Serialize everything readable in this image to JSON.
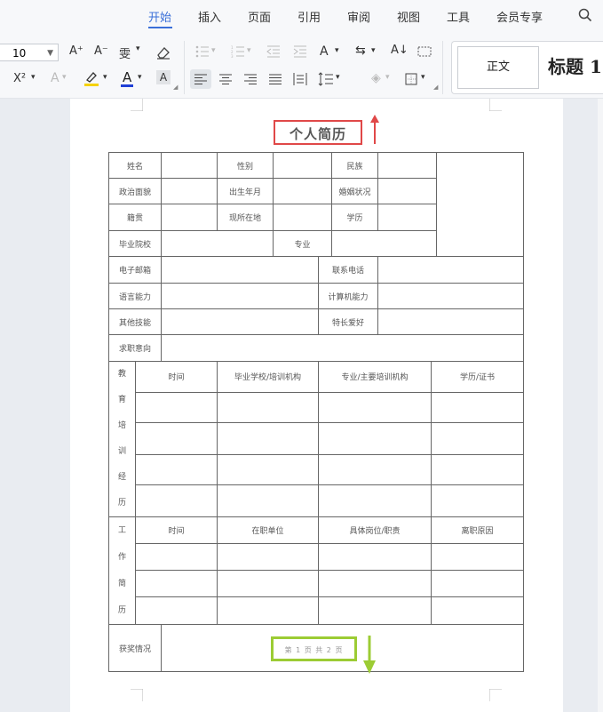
{
  "menu": {
    "items": [
      "开始",
      "插入",
      "页面",
      "引用",
      "审阅",
      "视图",
      "工具",
      "会员专享"
    ],
    "active": "开始"
  },
  "toolbar": {
    "font_size": "10",
    "grow_font": "A⁺",
    "shrink_font": "A⁻",
    "phonetic": "雯",
    "superscript": "X²",
    "font_color_letter": "A",
    "char_shading_letter": "A",
    "char_scale": "A",
    "style_normal": "正文",
    "style_heading1": "标题 1"
  },
  "document": {
    "title": "个人简历",
    "footer": "第 1 页 共 2 页",
    "labels": {
      "name": "姓名",
      "gender": "性别",
      "ethnicity": "民族",
      "political_status": "政治面貌",
      "birth_date": "出生年月",
      "marital_status": "婚姻状况",
      "hometown": "籍贯",
      "residence": "现所在地",
      "education": "学历",
      "school": "毕业院校",
      "major": "专业",
      "email": "电子邮箱",
      "phone": "联系电话",
      "language": "语言能力",
      "computer": "计算机能力",
      "other_skills": "其他技能",
      "hobbies": "特长爱好",
      "job_intention": "求职意向",
      "edu_section": "教育培训经历",
      "edu_time": "时间",
      "edu_school": "毕业学校/培训机构",
      "edu_major": "专业/主要培训机构",
      "edu_degree": "学历/证书",
      "work_section": "工作简历",
      "work_time": "时间",
      "work_unit": "在职单位",
      "work_position": "具体岗位/职责",
      "work_leave": "离职原因",
      "awards": "获奖情况"
    }
  },
  "colors": {
    "accent": "#3a6fd8",
    "title_highlight": "#e04848",
    "footer_highlight": "#9ccc34",
    "font_color_bar": "#1f3fd6",
    "highlight_color_bar": "#f5d200"
  }
}
